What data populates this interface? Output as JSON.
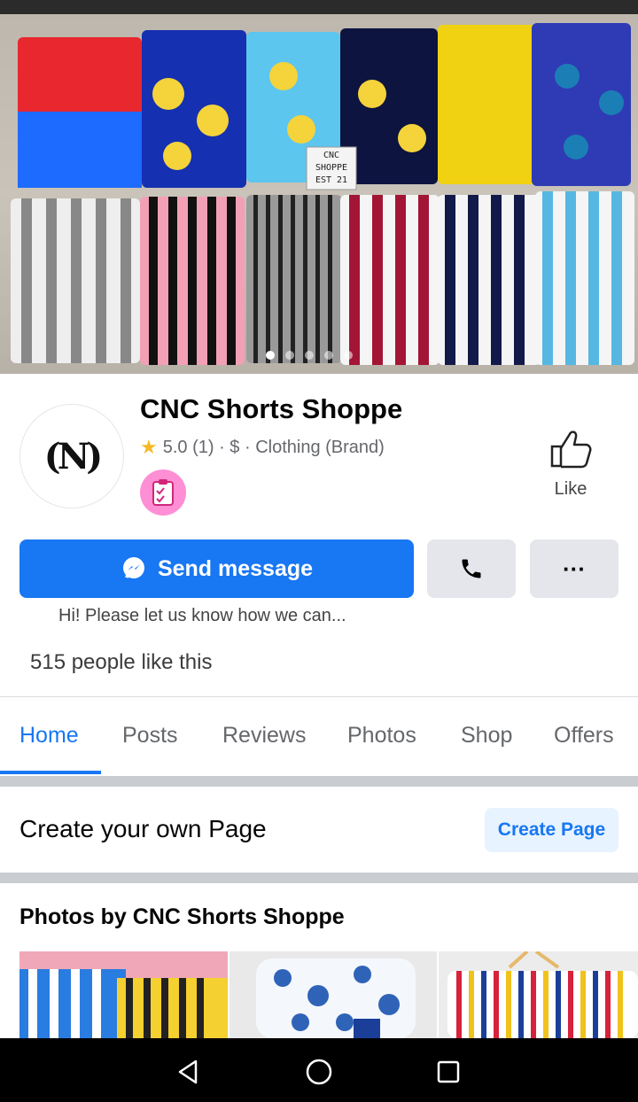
{
  "page": {
    "name": "CNC Shorts Shoppe",
    "avatar_text": "(N)",
    "rating_star": "★",
    "rating": "5.0 (1) · $ · Clothing (Brand)",
    "like_label": "Like"
  },
  "cover": {
    "sign_lines": [
      "CNC",
      "SHOPPE",
      "EST 21"
    ],
    "dot_count": 5,
    "active_dot": 0
  },
  "actions": {
    "send_message_label": "Send message",
    "more_label": "···",
    "auto_reply": "Hi! Please let us know how we can..."
  },
  "likes_count_text": "515 people like this",
  "tabs": [
    {
      "label": "Home",
      "active": true
    },
    {
      "label": "Posts",
      "active": false
    },
    {
      "label": "Reviews",
      "active": false
    },
    {
      "label": "Photos",
      "active": false
    },
    {
      "label": "Shop",
      "active": false
    },
    {
      "label": "Offers",
      "active": false
    }
  ],
  "create_page": {
    "title": "Create your own Page",
    "button_label": "Create Page"
  },
  "photos_section": {
    "title": "Photos by CNC Shorts Shoppe"
  },
  "colors": {
    "accent": "#1877f2",
    "accent_light": "#e7f3ff",
    "button_gray": "#e4e6eb",
    "badge_pink": "#ff8fd4",
    "star": "#f7b928"
  },
  "icons": {
    "messenger": "messenger-icon",
    "phone": "phone-icon",
    "like": "thumbs-up-icon",
    "badge": "clipboard-checklist-icon",
    "back": "nav-back-icon",
    "home": "nav-home-icon",
    "recents": "nav-recents-icon"
  }
}
